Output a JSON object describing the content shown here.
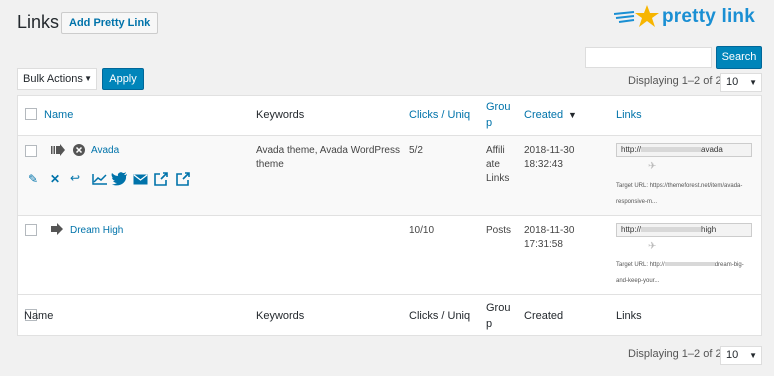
{
  "page": {
    "title": "Links",
    "add_button": "Add Pretty Link"
  },
  "logo": {
    "text": "pretty link"
  },
  "search": {
    "placeholder": "",
    "button": "Search"
  },
  "bulk": {
    "selected": "Bulk Actions",
    "apply": "Apply"
  },
  "pagination": {
    "displaying": "Displaying 1–2 of 2",
    "per_page": "10"
  },
  "table": {
    "columns": {
      "name": "Name",
      "keywords": "Keywords",
      "clicks": "Clicks / Uniq",
      "group_line1": "Grou",
      "group_line2": "p",
      "created": "Created",
      "links": "Links"
    },
    "rows": [
      {
        "name": "Avada",
        "keywords_line1": "Avada theme, Avada WordPress",
        "keywords_line2": "theme",
        "clicks": "5/2",
        "group_line1": "Affili",
        "group_line2": "ate",
        "group_line3": "Links",
        "created_date": "2018-11-30",
        "created_time": "18:32:43",
        "url_prefix": "http://",
        "url_suffix": "avada",
        "target_line1": "Target URL: https://themeforest.net/item/avada-",
        "target_line2": "responsive-m..."
      },
      {
        "name": "Dream High",
        "keywords_line1": "",
        "keywords_line2": "",
        "clicks": "10/10",
        "group_line1": "Posts",
        "created_date": "2018-11-30",
        "created_time": "17:31:58",
        "url_prefix": "http://",
        "url_suffix": "high",
        "target_line1": "Target URL: http://",
        "target_line1b": "dream-big-",
        "target_line2": "and-keep-your..."
      }
    ]
  },
  "colors": {
    "accent": "#0073aa",
    "button": "#0085ba",
    "logo": "#1a8fd3",
    "star": "#f7b500"
  }
}
